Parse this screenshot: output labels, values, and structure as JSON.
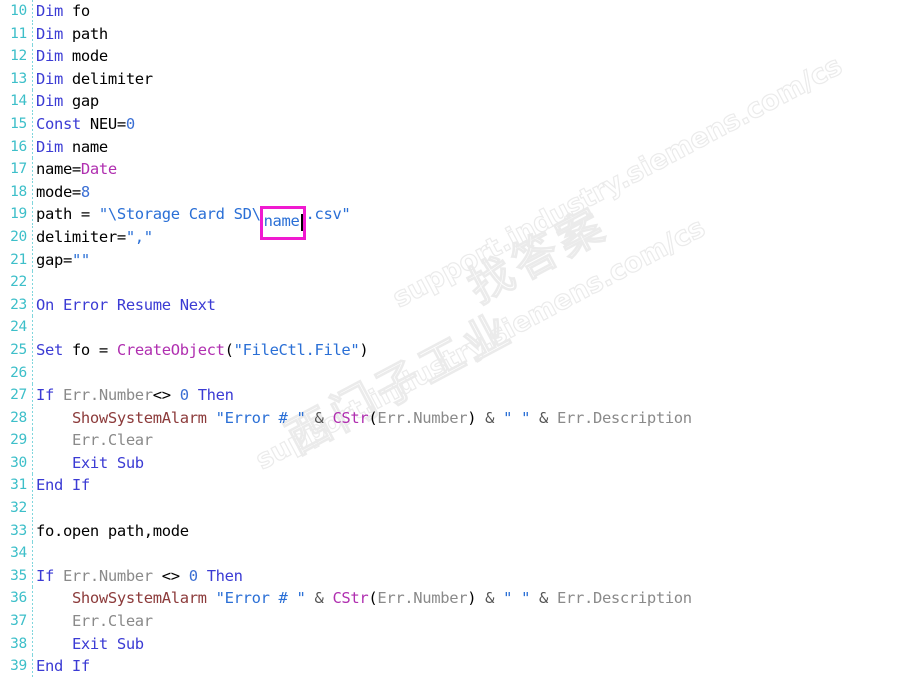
{
  "editor": {
    "language": "VBScript",
    "first_line_number": 10,
    "gutter_color": "#3dbfc9",
    "background": "#ffffff",
    "selection_box_color": "#f01ad0",
    "lines": [
      {
        "n": "10",
        "tokens": [
          {
            "t": "Dim",
            "c": "kw"
          },
          {
            "t": " fo",
            "c": "id"
          }
        ]
      },
      {
        "n": "11",
        "tokens": [
          {
            "t": "Dim",
            "c": "kw"
          },
          {
            "t": " path",
            "c": "id"
          }
        ]
      },
      {
        "n": "12",
        "tokens": [
          {
            "t": "Dim",
            "c": "kw"
          },
          {
            "t": " mode",
            "c": "id"
          }
        ]
      },
      {
        "n": "13",
        "tokens": [
          {
            "t": "Dim",
            "c": "kw"
          },
          {
            "t": " delimiter",
            "c": "id"
          }
        ]
      },
      {
        "n": "14",
        "tokens": [
          {
            "t": "Dim",
            "c": "kw"
          },
          {
            "t": " gap",
            "c": "id"
          }
        ]
      },
      {
        "n": "15",
        "tokens": [
          {
            "t": "Const",
            "c": "kw"
          },
          {
            "t": " NEU=",
            "c": "id"
          },
          {
            "t": "0",
            "c": "num"
          }
        ]
      },
      {
        "n": "16",
        "tokens": [
          {
            "t": "Dim",
            "c": "kw"
          },
          {
            "t": " name",
            "c": "id"
          }
        ]
      },
      {
        "n": "17",
        "tokens": [
          {
            "t": "name=",
            "c": "id"
          },
          {
            "t": "Date",
            "c": "fn"
          }
        ]
      },
      {
        "n": "18",
        "tokens": [
          {
            "t": "mode=",
            "c": "id"
          },
          {
            "t": "8",
            "c": "num"
          }
        ]
      },
      {
        "n": "19",
        "special": "path-line",
        "tokens": [
          {
            "t": "path = ",
            "c": "id"
          },
          {
            "t": "\"\\Storage Card SD\\",
            "c": "str"
          },
          {
            "t": "name",
            "c": "str",
            "boxed": true
          },
          {
            "t": ".csv\"",
            "c": "str"
          }
        ]
      },
      {
        "n": "20",
        "tokens": [
          {
            "t": "delimiter=",
            "c": "id"
          },
          {
            "t": "\",\"",
            "c": "str"
          }
        ]
      },
      {
        "n": "21",
        "tokens": [
          {
            "t": "gap=",
            "c": "id"
          },
          {
            "t": "\"\"",
            "c": "str"
          }
        ]
      },
      {
        "n": "22",
        "tokens": []
      },
      {
        "n": "23",
        "tokens": [
          {
            "t": "On Error Resume Next",
            "c": "kw"
          }
        ]
      },
      {
        "n": "24",
        "tokens": []
      },
      {
        "n": "25",
        "tokens": [
          {
            "t": "Set",
            "c": "kw"
          },
          {
            "t": " fo = ",
            "c": "id"
          },
          {
            "t": "CreateObject",
            "c": "fn"
          },
          {
            "t": "(",
            "c": "op"
          },
          {
            "t": "\"FileCtl.File\"",
            "c": "str"
          },
          {
            "t": ")",
            "c": "op"
          }
        ]
      },
      {
        "n": "26",
        "tokens": []
      },
      {
        "n": "27",
        "tokens": [
          {
            "t": "If",
            "c": "kw"
          },
          {
            "t": " ",
            "c": "id"
          },
          {
            "t": "Err.Number",
            "c": "obj"
          },
          {
            "t": "<> ",
            "c": "op"
          },
          {
            "t": "0",
            "c": "num"
          },
          {
            "t": " ",
            "c": "id"
          },
          {
            "t": "Then",
            "c": "kw"
          }
        ]
      },
      {
        "n": "28",
        "tokens": [
          {
            "t": "    ",
            "c": "id"
          },
          {
            "t": "ShowSystemAlarm",
            "c": "proc"
          },
          {
            "t": " ",
            "c": "id"
          },
          {
            "t": "\"Error # \"",
            "c": "str"
          },
          {
            "t": " & ",
            "c": "amp"
          },
          {
            "t": "CStr",
            "c": "fn"
          },
          {
            "t": "(",
            "c": "op"
          },
          {
            "t": "Err.Number",
            "c": "obj"
          },
          {
            "t": ")",
            "c": "op"
          },
          {
            "t": " & ",
            "c": "amp"
          },
          {
            "t": "\" \"",
            "c": "str"
          },
          {
            "t": " & ",
            "c": "amp"
          },
          {
            "t": "Err.Description",
            "c": "obj"
          }
        ]
      },
      {
        "n": "29",
        "tokens": [
          {
            "t": "    ",
            "c": "id"
          },
          {
            "t": "Err.Clear",
            "c": "obj"
          }
        ]
      },
      {
        "n": "30",
        "tokens": [
          {
            "t": "    ",
            "c": "id"
          },
          {
            "t": "Exit Sub",
            "c": "kw"
          }
        ]
      },
      {
        "n": "31",
        "tokens": [
          {
            "t": "End If",
            "c": "kw"
          }
        ]
      },
      {
        "n": "32",
        "tokens": []
      },
      {
        "n": "33",
        "tokens": [
          {
            "t": "fo.open path,mode",
            "c": "id"
          }
        ]
      },
      {
        "n": "34",
        "tokens": []
      },
      {
        "n": "35",
        "tokens": [
          {
            "t": "If",
            "c": "kw"
          },
          {
            "t": " ",
            "c": "id"
          },
          {
            "t": "Err.Number",
            "c": "obj"
          },
          {
            "t": " <> ",
            "c": "op"
          },
          {
            "t": "0",
            "c": "num"
          },
          {
            "t": " ",
            "c": "id"
          },
          {
            "t": "Then",
            "c": "kw"
          }
        ]
      },
      {
        "n": "36",
        "tokens": [
          {
            "t": "    ",
            "c": "id"
          },
          {
            "t": "ShowSystemAlarm",
            "c": "proc"
          },
          {
            "t": " ",
            "c": "id"
          },
          {
            "t": "\"Error # \"",
            "c": "str"
          },
          {
            "t": " & ",
            "c": "amp"
          },
          {
            "t": "CStr",
            "c": "fn"
          },
          {
            "t": "(",
            "c": "op"
          },
          {
            "t": "Err.Number",
            "c": "obj"
          },
          {
            "t": ")",
            "c": "op"
          },
          {
            "t": " & ",
            "c": "amp"
          },
          {
            "t": "\" \"",
            "c": "str"
          },
          {
            "t": " & ",
            "c": "amp"
          },
          {
            "t": "Err.Description",
            "c": "obj"
          }
        ]
      },
      {
        "n": "37",
        "tokens": [
          {
            "t": "    ",
            "c": "id"
          },
          {
            "t": "Err.Clear",
            "c": "obj"
          }
        ]
      },
      {
        "n": "38",
        "tokens": [
          {
            "t": "    ",
            "c": "id"
          },
          {
            "t": "Exit Sub",
            "c": "kw"
          }
        ]
      },
      {
        "n": "39",
        "tokens": [
          {
            "t": "End If",
            "c": "kw"
          }
        ]
      }
    ]
  },
  "watermark": {
    "url_line_1": "support.industry.siemens.com/cs",
    "url_line_2": "support.industry.siemens.com/cs",
    "cn_line_1": "找答案",
    "cn_line_2": "西门子工业",
    "color": "#ebebeb"
  }
}
